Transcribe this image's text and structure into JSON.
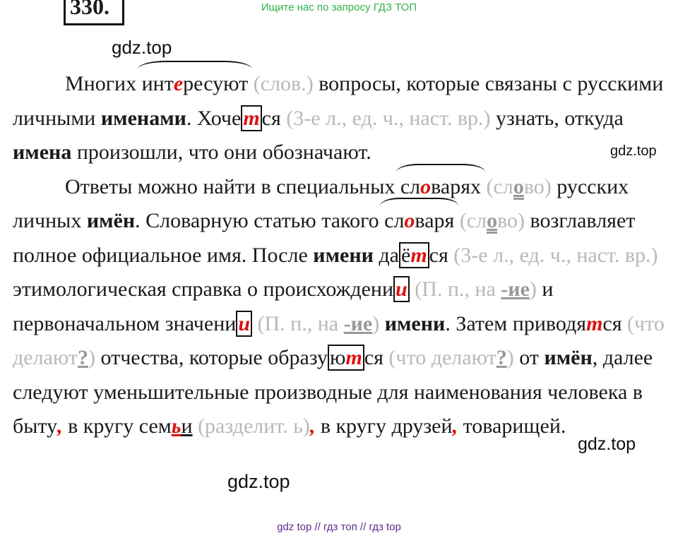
{
  "header": {
    "note": "Ищите нас по запросу ГДЗ ТОП",
    "number": "330."
  },
  "watermarks": [
    "gdz.top",
    "gdz.top",
    "gdz.top",
    "gdz.top"
  ],
  "text": {
    "p1": {
      "w1": "Многих ",
      "w2a": "инт",
      "w2e": "е",
      "w2b": "ресуют",
      "g1": " (слов.)",
      "w3": " вопросы, которые связаны с русскими личными ",
      "b1": "именами",
      "w4": ". Хоче",
      "m1": "т",
      "w5": "ся",
      "g2": " (3-е л., ед. ч., наст. вр.)",
      "w6": " узнать, откуда ",
      "b2": "имена",
      "w7": " произошли, что они обозначают."
    },
    "p2": {
      "w1": "Ответы можно найти в специальных ",
      "s1a": "сл",
      "s1o": "о",
      "s1b": "варях",
      "g1a": " (сл",
      "g1o": "о",
      "g1b": "во)",
      "w2": " русских личных ",
      "b1": "имён",
      "w3": ". Словарную статью такого ",
      "s2a": "сл",
      "s2o": "о",
      "s2b": "варя",
      "g2a": " (сл",
      "g2o": "о",
      "g2b": "во)",
      "w4": " возглавляет полное официальное имя. После ",
      "b2": "имени",
      "w5": " да",
      "e1": "ё",
      "m1": "т",
      "w6": "ся",
      "g3": " (3-е л., ед. ч., наст. вр.)",
      "w7": " этимологическая справка о происхождени",
      "m2": "и",
      "g4a": " (П. п., на ",
      "g4u": "-ие",
      "g4b": ")",
      "w8": " и первоначальном значени",
      "m3": "и",
      "g5a": " (П. п., на ",
      "g5u": "-ие",
      "g5b": ")",
      "w9": " ",
      "b3": "имени",
      "w10": ". Затем приводя",
      "r1": "т",
      "w11": "ся",
      "g6a": " (что делают",
      "g6u": "?",
      "g6b": ")",
      "w12": " отчества, которые образу",
      "m4a": "ю",
      "m4b": "т",
      "w13": "ся",
      "g7a": " (что делают",
      "g7u": "?",
      "g7b": ")",
      "w14": " от ",
      "b4": "имён",
      "w15": ", далее следуют уменьшительные производные для наименования человека в быту",
      "c1": ",",
      "w16": " в кругу сем",
      "r2": "ь",
      "u1": "и",
      "g8": " (разделит. ь)",
      "c2": ",",
      "w17": " в кругу друзей",
      "c3": ",",
      "w18": " товарищей."
    }
  },
  "footer": "gdz top  //  гдз топ  //  гдз top"
}
